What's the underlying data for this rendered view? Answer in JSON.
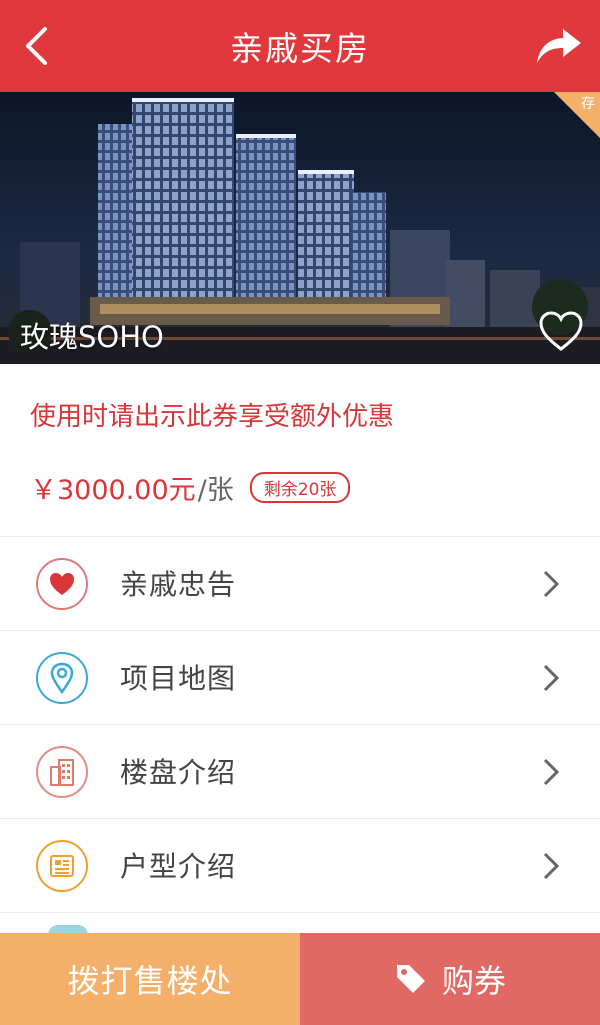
{
  "header": {
    "title": "亲戚买房",
    "back_icon": "back-arrow-icon",
    "share_icon": "share-arrow-icon",
    "background": "#e0383c"
  },
  "hero": {
    "project_name": "玫瑰SOHO",
    "corner_tag": "存",
    "favorite_icon": "heart-outline-icon"
  },
  "info": {
    "notice": "使用时请出示此券享受额外优惠",
    "price": "￥3000.00元",
    "unit": "/张",
    "remaining": "剩余20张",
    "accent": "#d9363a"
  },
  "menu": {
    "items": [
      {
        "label": "亲戚忠告",
        "icon": "heart-icon",
        "color": "#d9363a"
      },
      {
        "label": "项目地图",
        "icon": "map-pin-icon",
        "color": "#3aa8d8"
      },
      {
        "label": "楼盘介绍",
        "icon": "building-icon",
        "color": "#e07a6a"
      },
      {
        "label": "户型介绍",
        "icon": "document-icon",
        "color": "#f0a030"
      }
    ]
  },
  "bottom_bar": {
    "call_label": "拨打售楼处",
    "buy_label": "购券",
    "call_color": "#f4b06b",
    "buy_color": "#e06a63"
  }
}
